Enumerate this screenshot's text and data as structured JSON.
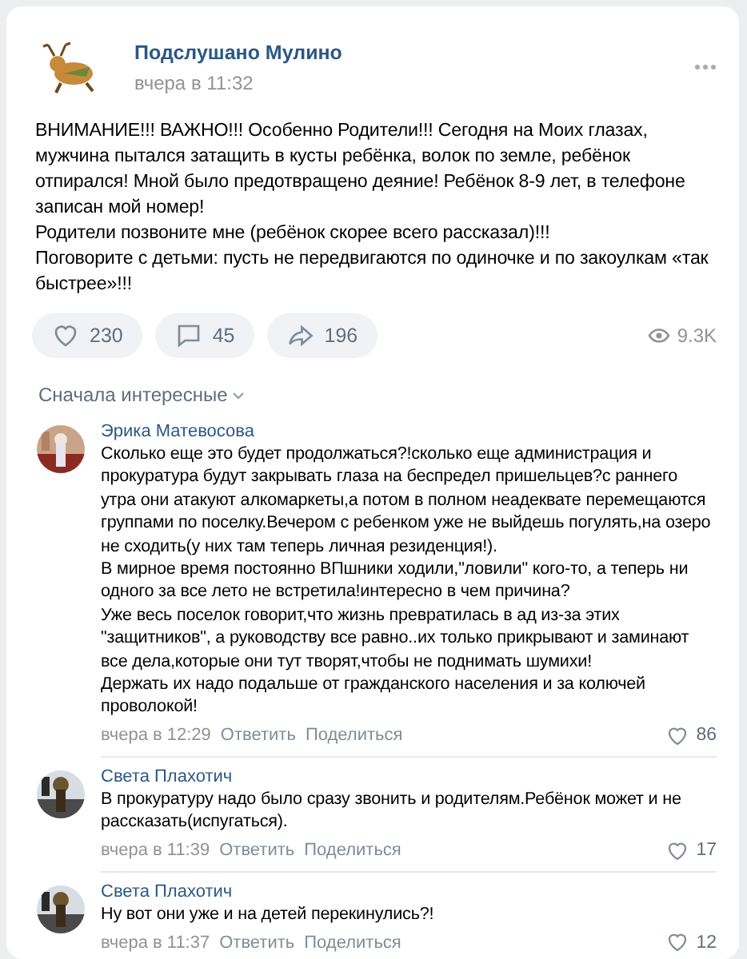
{
  "post": {
    "author": "Подслушано Мулино",
    "time": "вчера в 11:32",
    "paragraphs": [
      "ВНИМАНИЕ!!! ВАЖНО!!! Особенно Родители!!! Сегодня на Моих глазах, мужчина пытался затащить в кусты ребёнка, волок по земле, ребёнок отпирался! Мной было предотвращено деяние! Ребёнок 8-9 лет, в телефоне записан мой номер!",
      "Родители позвоните мне (ребёнок скорее всего рассказал)!!!",
      "Поговорите с детьми: пусть не передвигаются по одиночке и по закоулкам «так быстрее»!!!"
    ],
    "actions": [
      {
        "kind": "like",
        "count": "230"
      },
      {
        "kind": "comment",
        "count": "45"
      },
      {
        "kind": "share",
        "count": "196"
      }
    ],
    "views": "9.3K"
  },
  "sort": "Сначала интересные",
  "comments": [
    {
      "author": "Эрика Матевосова",
      "paragraphs": [
        "Сколько еще это будет продолжаться?!сколько еще администрация и прокуратура будут закрывать глаза на беспредел пришельцев?с раннего утра они атакуют алкомаркеты,а потом в полном неадеквате перемещаются группами по поселку.Вечером с ребенком уже не выйдешь погулять,на озеро не сходить(у них там теперь личная резиденция!).",
        "В мирное время постоянно ВПшники ходили,\"ловили\" кого-то, а теперь ни одного за все лето не встретила!интересно в чем причина?",
        "Уже весь поселок говорит,что жизнь превратилась в ад из-за этих \"защитников\", а руководству все равно..их только прикрывают и заминают все дела,которые они тут творят,чтобы не поднимать шумихи!",
        "Держать их надо подальше от гражданского населения и за колючей проволокой!"
      ],
      "time": "вчера в 12:29",
      "reply": "Ответить",
      "share": "Поделиться",
      "likes": "86"
    },
    {
      "author": "Света Плахотич",
      "paragraphs": [
        "В прокуратуру надо было сразу звонить и родителям.Ребёнок может и не рассказать(испугаться)."
      ],
      "time": "вчера в 11:39",
      "reply": "Ответить",
      "share": "Поделиться",
      "likes": "17"
    },
    {
      "author": "Света Плахотич",
      "paragraphs": [
        "Ну вот они уже и на детей перекинулись?!"
      ],
      "time": "вчера в 11:37",
      "reply": "Ответить",
      "share": "Поделиться",
      "likes": "12"
    }
  ]
}
